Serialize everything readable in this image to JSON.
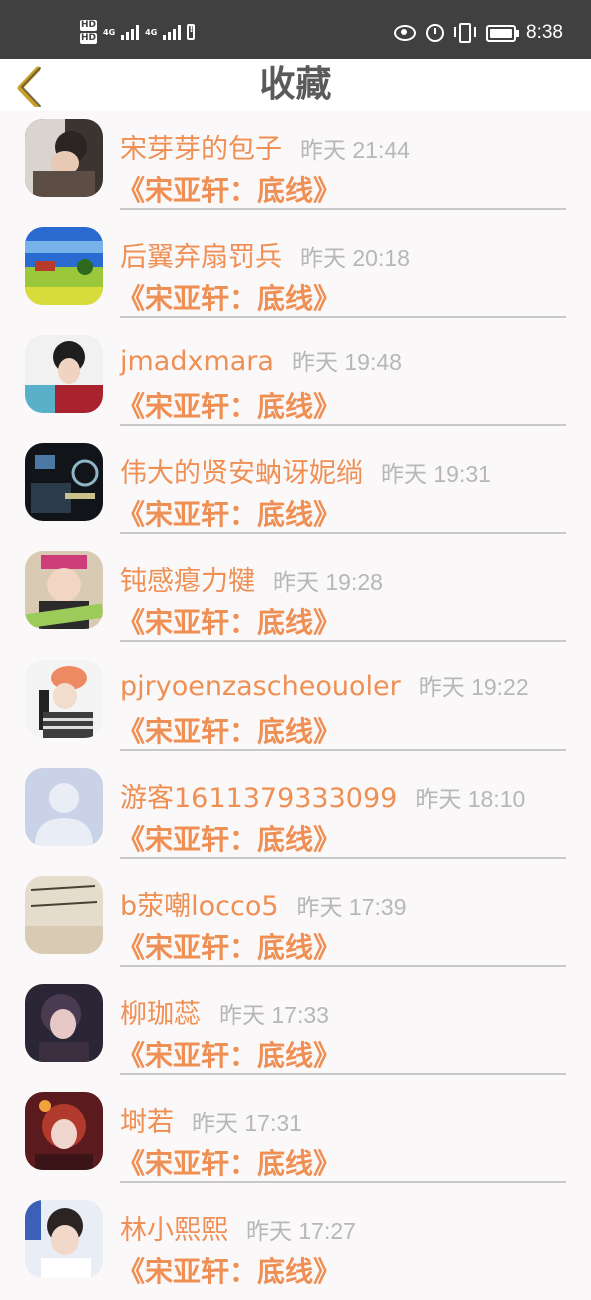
{
  "status_bar": {
    "network_labels": [
      "HD",
      "HD",
      "4G",
      "4G"
    ],
    "time": "8:38",
    "icons": [
      "eye-icon",
      "alarm-icon",
      "vibrate-icon",
      "battery-icon"
    ]
  },
  "header": {
    "title": "收藏",
    "back_icon": "chevron-left-icon"
  },
  "colors": {
    "accent": "#ef8f53",
    "time_gray": "#b7b7b7",
    "status_bar_bg": "#404040",
    "back_icon": "#c8a02a"
  },
  "items": [
    {
      "name": "宋芽芽的包子",
      "time": "昨天 21:44",
      "work": "《宋亚轩：底线》"
    },
    {
      "name": "后翼弃扇罚兵",
      "time": "昨天 20:18",
      "work": "《宋亚轩：底线》"
    },
    {
      "name": "jmadxmara",
      "time": "昨天 19:48",
      "work": "《宋亚轩：底线》"
    },
    {
      "name": "伟大的贤安蚋讶妮绱",
      "time": "昨天 19:31",
      "work": "《宋亚轩：底线》"
    },
    {
      "name": "钝感瘪力犍",
      "time": "昨天 19:28",
      "work": "《宋亚轩：底线》"
    },
    {
      "name": "pjryoenzascheouoler",
      "time": "昨天 19:22",
      "work": "《宋亚轩：底线》"
    },
    {
      "name": "游客1611379333099",
      "time": "昨天 18:10",
      "work": "《宋亚轩：底线》"
    },
    {
      "name": "b荥嘲locco5",
      "time": "昨天 17:39",
      "work": "《宋亚轩：底线》"
    },
    {
      "name": "柳珈蕊",
      "time": "昨天 17:33",
      "work": "《宋亚轩：底线》"
    },
    {
      "name": "埘若",
      "time": "昨天 17:31",
      "work": "《宋亚轩：底线》"
    },
    {
      "name": "林小熙熙",
      "time": "昨天 17:27",
      "work": "《宋亚轩：底线》"
    }
  ]
}
